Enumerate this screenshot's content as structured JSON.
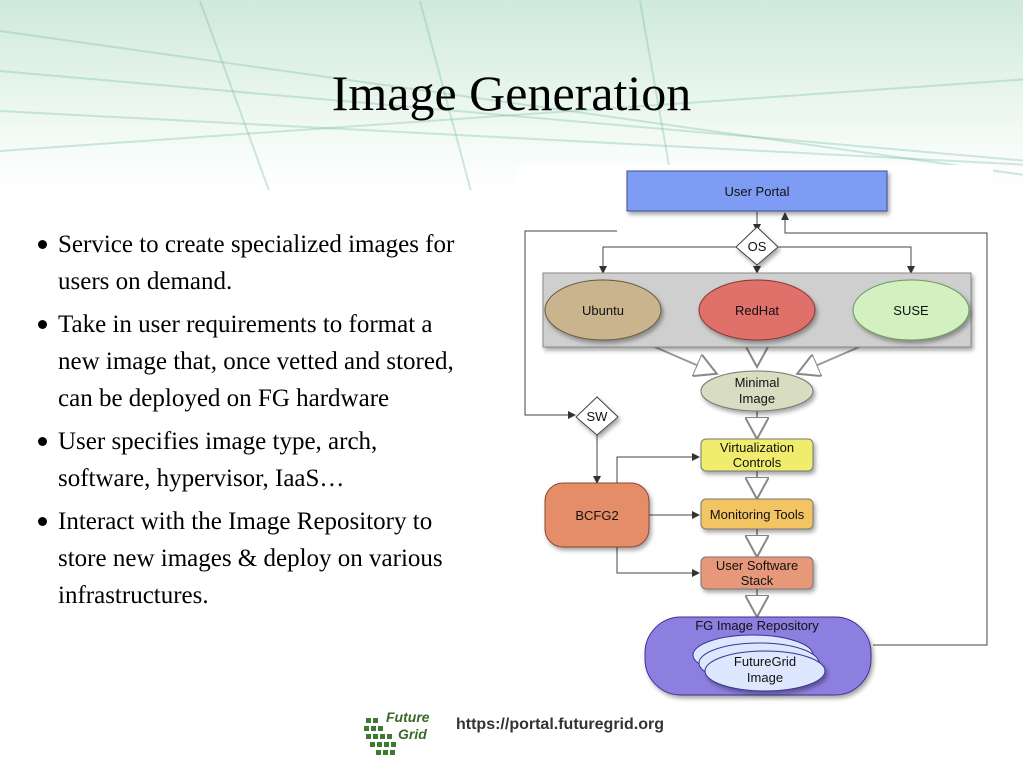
{
  "slide": {
    "title": "Image Generation",
    "bullets": [
      "Service to create specialized images for users on demand.",
      "Take in user requirements to format a new image that, once vetted and stored, can be deployed on FG hardware",
      "User specifies image type, arch, software, hypervisor, IaaS…",
      "Interact with the Image Repository to store new images & deploy on various infrastructures."
    ],
    "footer_url": "https://portal.futuregrid.org",
    "logo_line1": "Future",
    "logo_line2": "Grid"
  },
  "diagram": {
    "user_portal": "User Portal",
    "os_decision": "OS",
    "sw_decision": "SW",
    "os_options": [
      "Ubuntu",
      "RedHat",
      "SUSE"
    ],
    "minimal_image": [
      "Minimal",
      "Image"
    ],
    "virtualization_controls": [
      "Virtualization",
      "Controls"
    ],
    "monitoring_tools": "Monitoring Tools",
    "user_software_stack": [
      "User Software",
      "Stack"
    ],
    "bcfg2": "BCFG2",
    "repository": "FG Image Repository",
    "repository_image": [
      "FutureGrid",
      "Image"
    ],
    "colors": {
      "portal": "#7f9cf5",
      "ubuntu": "#c9b48e",
      "redhat": "#e0706a",
      "suse": "#d3f0c0",
      "minimal": "#d8dcc0",
      "yellow_box": "#f0ec6e",
      "orange_box": "#f3c462",
      "software_box": "#e8987a",
      "bcfg2": "#e58c68",
      "repository": "#8d7fe0",
      "repo_image": "#dde8ff"
    }
  }
}
